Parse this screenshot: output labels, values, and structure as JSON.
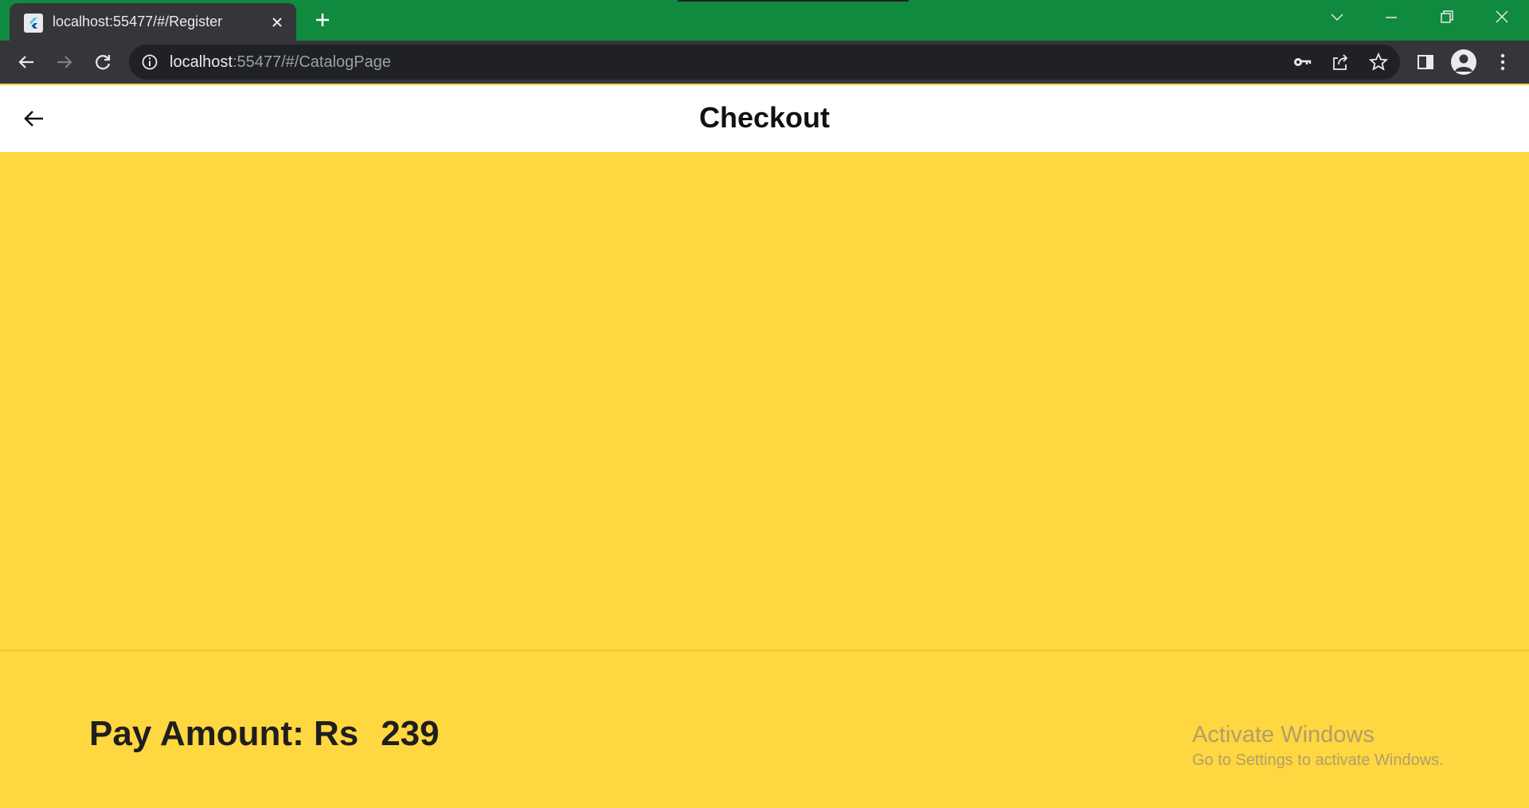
{
  "browser": {
    "tab_title": "localhost:55477/#/Register",
    "url_host": "localhost",
    "url_rest": ":55477/#/CatalogPage"
  },
  "appbar": {
    "title": "Checkout"
  },
  "footer": {
    "pay_label": "Pay Amount: Rs",
    "pay_amount": "239"
  },
  "watermark": {
    "title": "Activate Windows",
    "subtitle": "Go to Settings to activate Windows."
  },
  "colors": {
    "tabstrip": "#108a3e",
    "toolbar": "#35363a",
    "body_background": "#ffd740",
    "appbar": "#ffffff"
  },
  "icons": [
    "flutter-favicon-icon",
    "tab-close-icon",
    "new-tab-icon",
    "tab-search-chevron-icon",
    "minimize-icon",
    "restore-icon",
    "window-close-icon",
    "back-icon",
    "forward-icon",
    "reload-icon",
    "site-info-icon",
    "key-icon",
    "share-icon",
    "bookmark-star-icon",
    "side-panel-icon",
    "profile-icon",
    "kebab-menu-icon",
    "arrow-back-icon"
  ]
}
